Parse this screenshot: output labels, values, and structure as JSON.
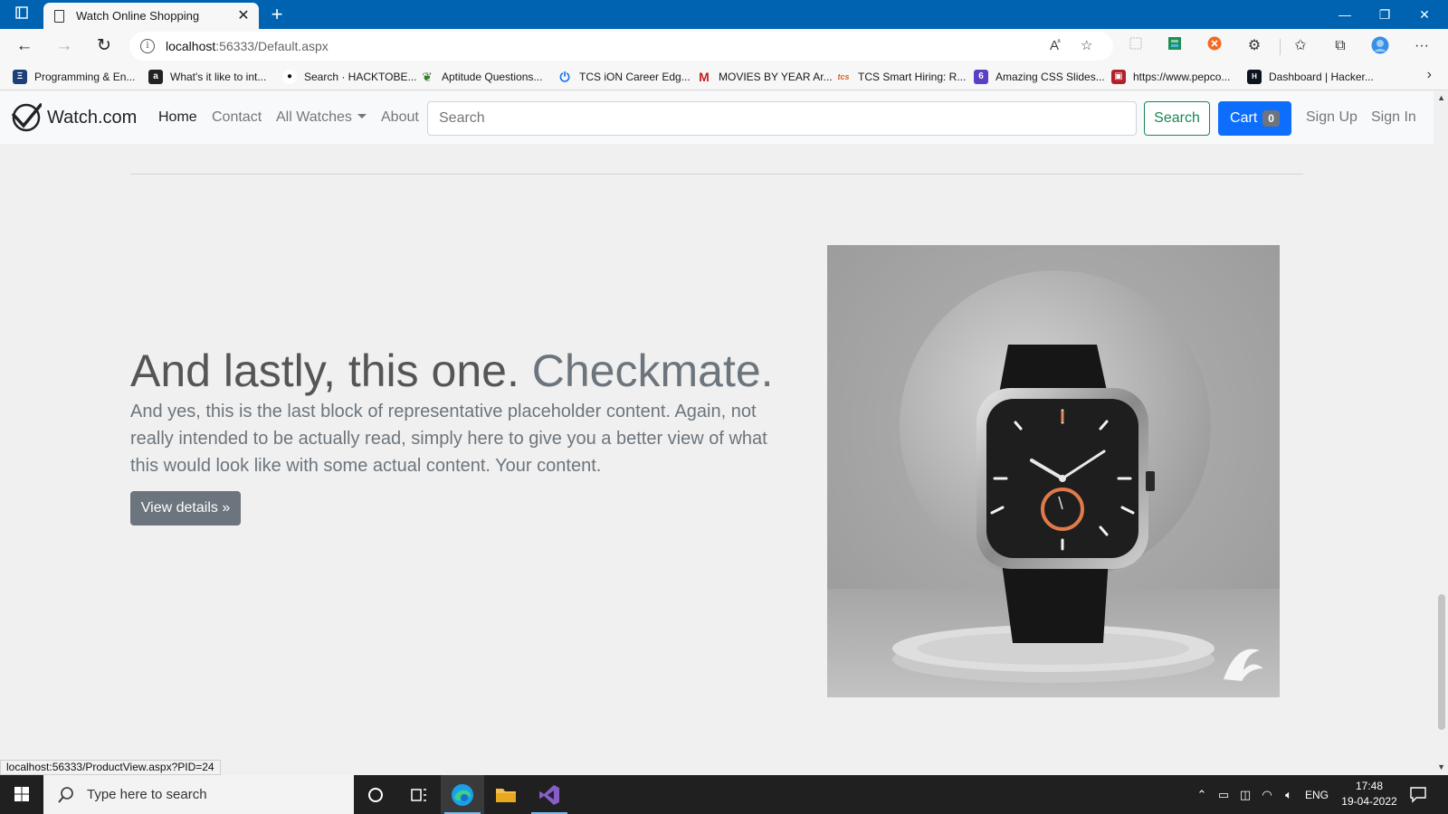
{
  "browser": {
    "tab_title": "Watch Online Shopping",
    "url_host": "localhost",
    "url_rest": ":56333/Default.aspx",
    "status_url": "localhost:56333/ProductView.aspx?PID=24"
  },
  "bookmarks": [
    {
      "label": "Programming & En...",
      "icon": "bookmark-site-icon",
      "color": "#1e3f77"
    },
    {
      "label": "What's it like to int...",
      "icon": "amazon-icon",
      "color": "#222222"
    },
    {
      "label": "Search · HACKTOBE...",
      "icon": "github-icon",
      "color": "#111111"
    },
    {
      "label": "Aptitude Questions...",
      "icon": "leaf-icon",
      "color": "#3a7d2c"
    },
    {
      "label": "TCS iON Career Edg...",
      "icon": "power-icon",
      "color": "#1a73e8"
    },
    {
      "label": "MOVIES BY YEAR Ar...",
      "icon": "gmail-icon",
      "color": "#c5221f"
    },
    {
      "label": "TCS Smart Hiring: R...",
      "icon": "tcs-icon",
      "color": "#e25d24"
    },
    {
      "label": "Amazing CSS Slides...",
      "icon": "six-icon",
      "color": "#5b3fc4"
    },
    {
      "label": "https://www.pepco...",
      "icon": "box-icon",
      "color": "#b3202a"
    },
    {
      "label": "Dashboard | Hacker...",
      "icon": "hackerrank-icon",
      "color": "#0e141e"
    }
  ],
  "site": {
    "brand": "Watch.com",
    "nav": {
      "home": "Home",
      "contact": "Contact",
      "all_watches": "All Watches",
      "about": "About"
    },
    "search_placeholder": "Search",
    "search_button": "Search",
    "cart_label": "Cart",
    "cart_count": "0",
    "sign_up": "Sign Up",
    "sign_in": "Sign In"
  },
  "feature": {
    "heading": "And lastly, this one.",
    "heading_muted": "Checkmate.",
    "lead": "And yes, this is the last block of representative placeholder content. Again, not really intended to be actually read, simply here to give you a better view of what this would look like with some actual content. Your content.",
    "button": "View details »"
  },
  "taskbar": {
    "search_placeholder": "Type here to search",
    "language": "ENG",
    "time": "17:48",
    "date": "19-04-2022"
  },
  "colors": {
    "titlebar": "#0063b1",
    "primary": "#0d6efd",
    "success": "#198754",
    "secondary": "#6c757d"
  }
}
